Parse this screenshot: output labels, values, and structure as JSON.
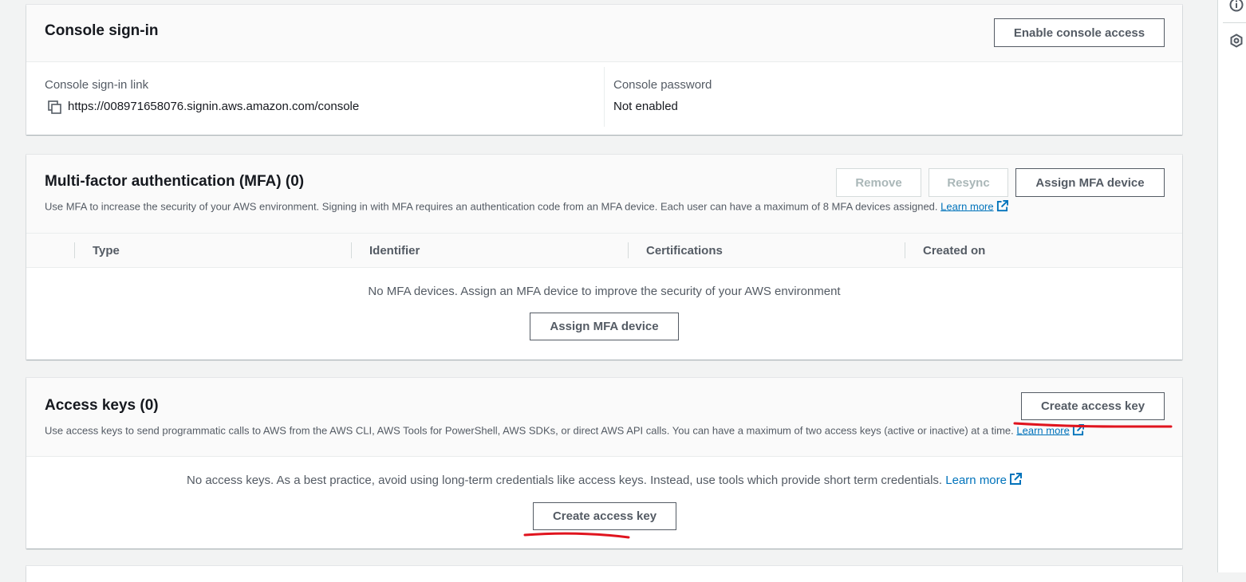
{
  "console_signin": {
    "title": "Console sign-in",
    "enable_button": "Enable console access",
    "link_label": "Console sign-in link",
    "link_value": "https://008971658076.signin.aws.amazon.com/console",
    "password_label": "Console password",
    "password_value": "Not enabled"
  },
  "mfa": {
    "title": "Multi-factor authentication (MFA) (0)",
    "description": "Use MFA to increase the security of your AWS environment. Signing in with MFA requires an authentication code from an MFA device. Each user can have a maximum of 8 MFA devices assigned.",
    "learn_more": "Learn more",
    "remove_button": "Remove",
    "resync_button": "Resync",
    "assign_button": "Assign MFA device",
    "columns": [
      "Type",
      "Identifier",
      "Certifications",
      "Created on"
    ],
    "empty_text": "No MFA devices. Assign an MFA device to improve the security of your AWS environment",
    "empty_assign_button": "Assign MFA device"
  },
  "access_keys": {
    "title": "Access keys (0)",
    "description": "Use access keys to send programmatic calls to AWS from the AWS CLI, AWS Tools for PowerShell, AWS SDKs, or direct AWS API calls. You can have a maximum of two access keys (active or inactive) at a time.",
    "learn_more": "Learn more",
    "create_button": "Create access key",
    "empty_text": "No access keys. As a best practice, avoid using long-term credentials like access keys. Instead, use tools which provide short term credentials.",
    "empty_learn_more": "Learn more",
    "empty_create_button": "Create access key"
  },
  "right_panel": {
    "icons": [
      "info-icon",
      "hexagon-settings-icon"
    ]
  },
  "colors": {
    "link": "#0073bb",
    "annotation": "#e0141e",
    "background": "#f2f3f3"
  }
}
